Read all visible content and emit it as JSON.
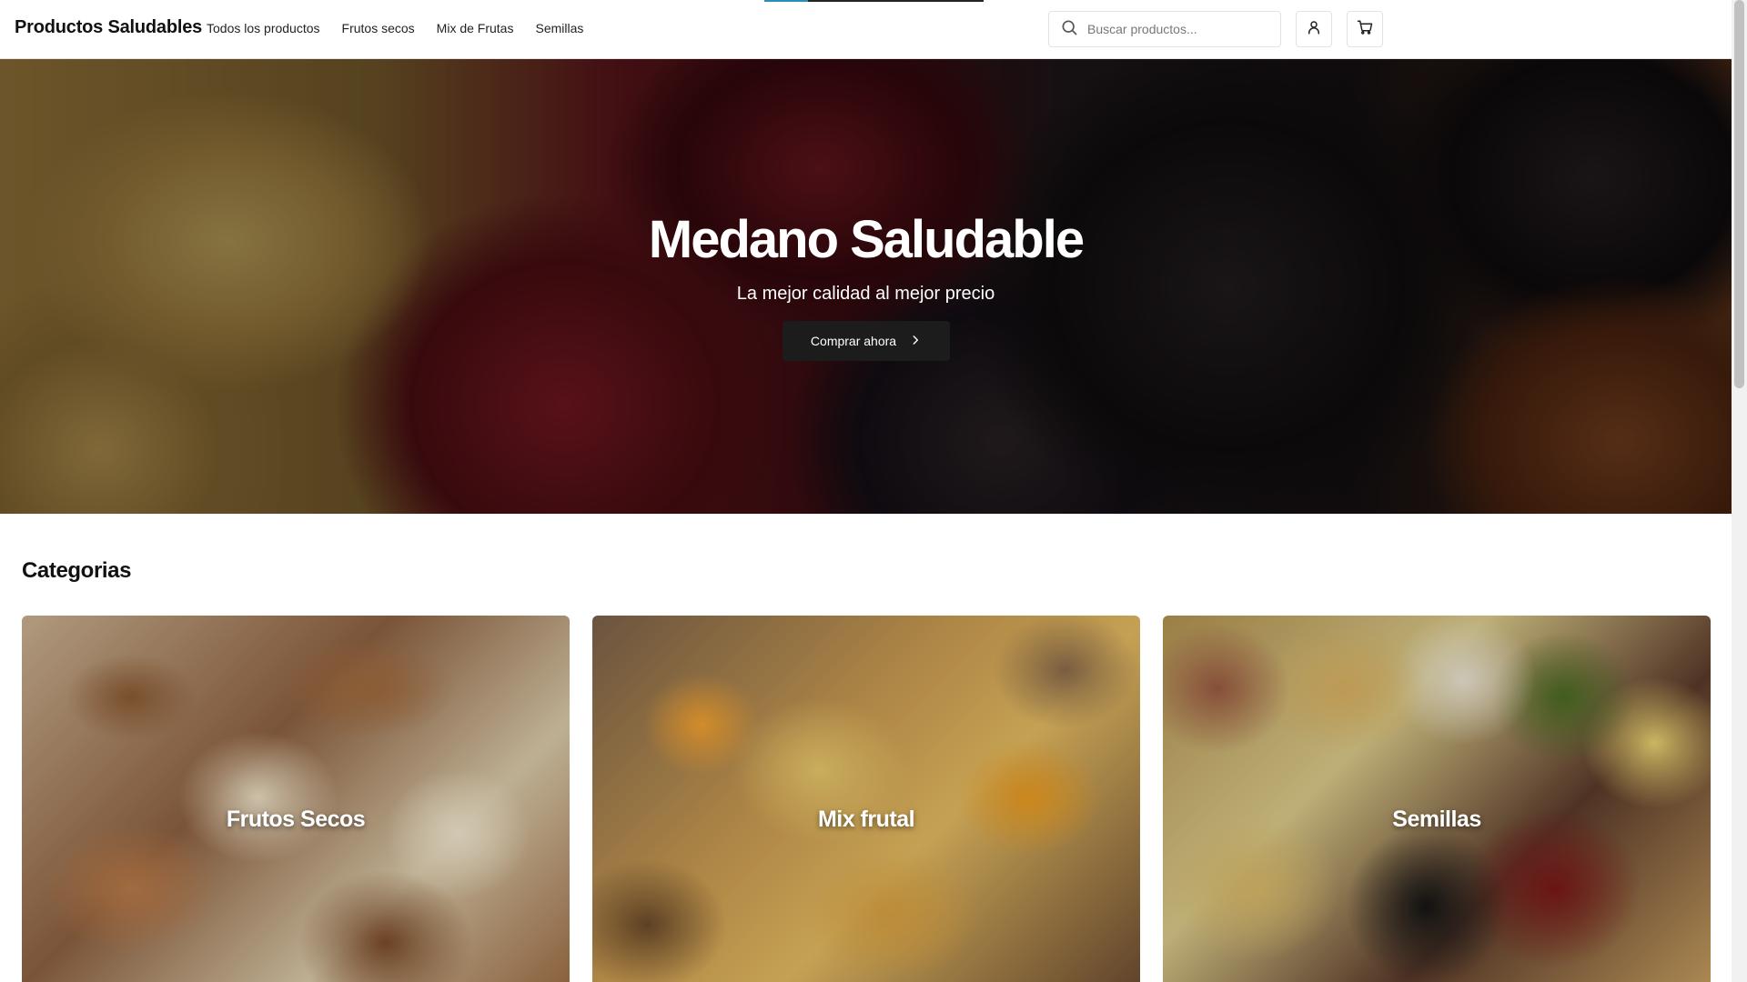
{
  "header": {
    "brand": "Productos Saludables",
    "nav": [
      {
        "label": "Todos los productos"
      },
      {
        "label": "Frutos secos"
      },
      {
        "label": "Mix de Frutas"
      },
      {
        "label": "Semillas"
      }
    ],
    "search": {
      "placeholder": "Buscar productos..."
    },
    "icons": {
      "search": "search-icon",
      "user": "user-icon",
      "cart": "cart-icon"
    }
  },
  "hero": {
    "title": "Medano Saludable",
    "subtitle": "La mejor calidad al mejor precio",
    "cta_label": "Comprar ahora",
    "cta_icon": "chevron-right-icon"
  },
  "categories": {
    "title": "Categorias",
    "items": [
      {
        "label": "Frutos Secos"
      },
      {
        "label": "Mix frutal"
      },
      {
        "label": "Semillas"
      }
    ]
  },
  "colors": {
    "accent": "#2a8fb5",
    "dark": "#1c1c1c",
    "border": "#e2e2e2"
  }
}
